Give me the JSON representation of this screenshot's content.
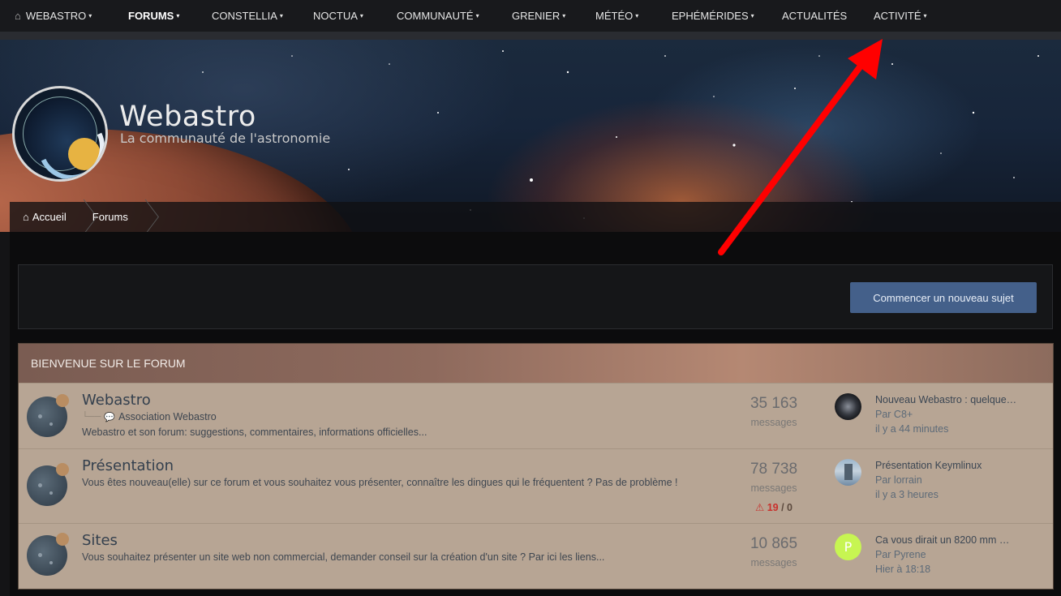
{
  "nav": {
    "items": [
      {
        "label": "WEBASTRO",
        "caret": "▾"
      },
      {
        "label": "FORUMS",
        "caret": "▾"
      },
      {
        "label": "CONSTELLIA",
        "caret": "▾"
      },
      {
        "label": "NOCTUA",
        "caret": "▾"
      },
      {
        "label": "COMMUNAUTÉ",
        "caret": "▾"
      },
      {
        "label": "GRENIER",
        "caret": "▾"
      },
      {
        "label": "MÉTÉO",
        "caret": "▾"
      },
      {
        "label": "EPHÉMÉRIDES",
        "caret": "▾"
      },
      {
        "label": "ACTUALITÉS",
        "caret": ""
      },
      {
        "label": "ACTIVITÉ",
        "caret": "▾"
      }
    ],
    "home_icon": "home-icon"
  },
  "header": {
    "title": "Webastro",
    "subtitle": "La communauté de l'astronomie"
  },
  "breadcrumb": {
    "items": [
      {
        "label": "Accueil",
        "icon": "home-icon"
      },
      {
        "label": "Forums"
      }
    ]
  },
  "actions": {
    "new_topic_label": "Commencer un nouveau sujet"
  },
  "forum": {
    "section_title": "BIENVENUE SUR LE FORUM",
    "rows": [
      {
        "title": "Webastro",
        "subforum": "Association Webastro",
        "description": "Webastro et son forum: suggestions, commentaires, informations officielles...",
        "count": "35 163",
        "count_label": "messages",
        "last_title": "Nouveau Webastro : quelque…",
        "last_by": "Par C8+",
        "last_time": "il y a 44 minutes"
      },
      {
        "title": "Présentation",
        "description": "Vous êtes nouveau(elle) sur ce forum et vous souhaitez vous présenter, connaître les dingues qui le fréquentent ? Pas de problème !",
        "count": "78 738",
        "count_label": "messages",
        "warn_red": "19",
        "warn_sep": "/",
        "warn_dark": "0",
        "last_title": "Présentation Keymlinux",
        "last_by": "Par lorrain",
        "last_time": "il y a 3 heures"
      },
      {
        "title": "Sites",
        "description": "Vous souhaitez présenter un site web non commercial, demander conseil sur la création d'un site ? Par ici les liens...",
        "count": "10 865",
        "count_label": "messages",
        "avatar_letter": "P",
        "last_title": "Ca vous dirait un 8200 mm …",
        "last_by": "Par Pyrene",
        "last_time": "Hier à 18:18"
      }
    ]
  },
  "colors": {
    "nav_bg": "#18191c",
    "button": "#44608a",
    "forum_row_bg": "#b7a594",
    "annotation_arrow": "#ff0000",
    "warning": "#c9302c"
  }
}
